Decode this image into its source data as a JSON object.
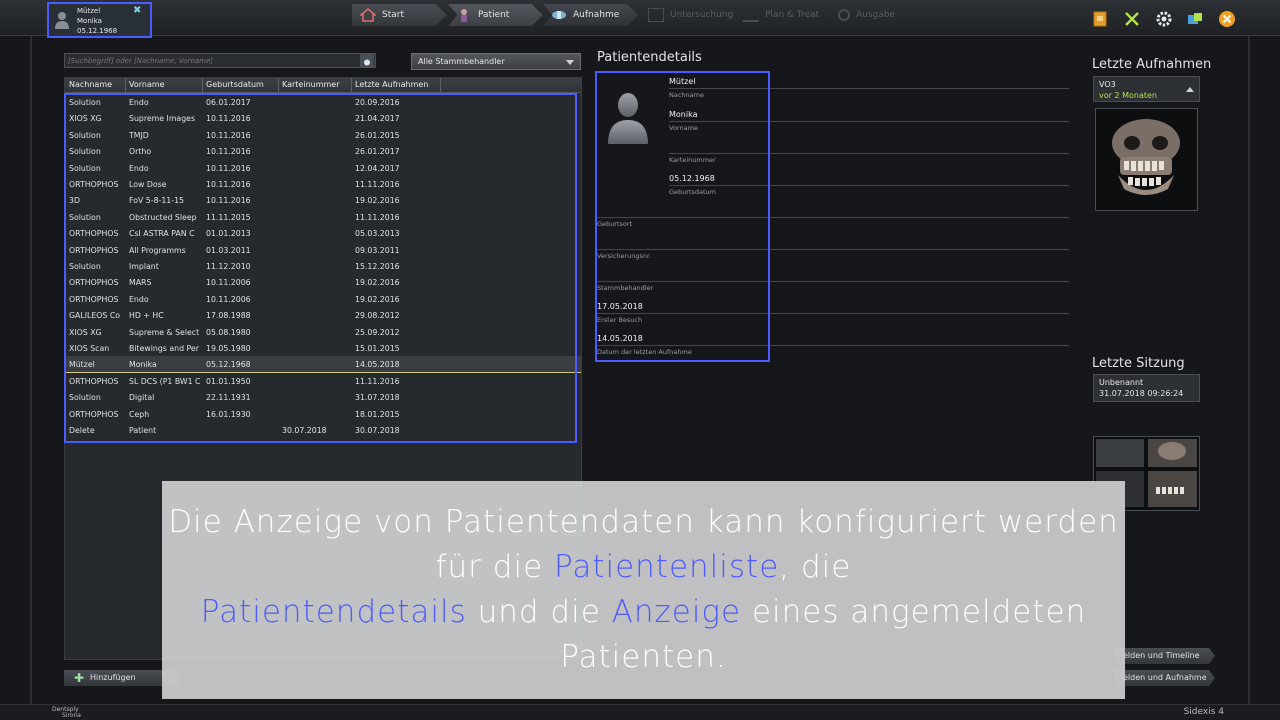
{
  "active_patient": {
    "lastname": "Mützel",
    "firstname": "Monika",
    "birthdate": "05.12.1968"
  },
  "workflow": {
    "start": "Start",
    "patient": "Patient",
    "aufnahme": "Aufnahme",
    "untersuchung": "Untersuchung",
    "plan": "Plan & Treat",
    "ausgabe": "Ausgabe"
  },
  "search": {
    "placeholder": "[Suchbegriff] oder [Nachname, Vorname]",
    "doctor_filter": "Alle Stammbehandler"
  },
  "table": {
    "headers": [
      "Nachname",
      "Vorname",
      "Geburtsdatum",
      "Karteinummer",
      "Letzte Aufnahmen"
    ],
    "rows": [
      [
        "Solution",
        "Endo",
        "06.01.2017",
        "",
        "20.09.2016"
      ],
      [
        "XIOS XG",
        "Supreme Images",
        "10.11.2016",
        "",
        "21.04.2017"
      ],
      [
        "Solution",
        "TMJD",
        "10.11.2016",
        "",
        "26.01.2015"
      ],
      [
        "Solution",
        "Ortho",
        "10.11.2016",
        "",
        "26.01.2017"
      ],
      [
        "Solution",
        "Endo",
        "10.11.2016",
        "",
        "12.04.2017"
      ],
      [
        "ORTHOPHOS",
        "Low Dose",
        "10.11.2016",
        "",
        "11.11.2016"
      ],
      [
        "3D",
        "FoV 5-8-11-15",
        "10.11.2016",
        "",
        "19.02.2016"
      ],
      [
        "Solution",
        "Obstructed Sleep",
        "11.11.2015",
        "",
        "11.11.2016"
      ],
      [
        "ORTHOPHOS",
        "CsI ASTRA PAN C",
        "01.01.2013",
        "",
        "05.03.2013"
      ],
      [
        "ORTHOPHOS",
        "All Programms",
        "01.03.2011",
        "",
        "09.03.2011"
      ],
      [
        "Solution",
        "Implant",
        "11.12.2010",
        "",
        "15.12.2016"
      ],
      [
        "ORTHOPHOS",
        "MARS",
        "10.11.2006",
        "",
        "19.02.2016"
      ],
      [
        "ORTHOPHOS",
        "Endo",
        "10.11.2006",
        "",
        "19.02.2016"
      ],
      [
        "GALILEOS Co",
        "HD + HC",
        "17.08.1988",
        "",
        "29.08.2012"
      ],
      [
        "XIOS XG",
        "Supreme & Select",
        "05.08.1980",
        "",
        "25.09.2012"
      ],
      [
        "XIOS Scan",
        "Bitewings and Per",
        "19.05.1980",
        "",
        "15.01.2015"
      ],
      [
        "Mützel",
        "Monika",
        "05.12.1968",
        "",
        "14.05.2018"
      ],
      [
        "ORTHOPHOS",
        "SL DCS (P1 BW1 C",
        "01.01.1950",
        "",
        "11.11.2016"
      ],
      [
        "Solution",
        "Digital",
        "22.11.1931",
        "",
        "31.07.2018"
      ],
      [
        "ORTHOPHOS",
        "Ceph",
        "16.01.1930",
        "",
        "18.01.2015"
      ],
      [
        "Delete",
        "Patient",
        "",
        "30.07.2018",
        "30.07.2018"
      ]
    ],
    "selected_index": 16
  },
  "add_button": "Hinzufügen",
  "details": {
    "title": "Patientendetails",
    "nachname_value": "Mützel",
    "nachname_label": "Nachname",
    "vorname_value": "Monika",
    "vorname_label": "Vorname",
    "karteinummer_label": "Karteinummer",
    "geburtsdatum_value": "05.12.1968",
    "geburtsdatum_label": "Geburtsdatum",
    "geburtsort_label": "Geburtsort",
    "versicherung_label": "Versicherungsnr.",
    "stammbehandler_label": "Stammbehandler",
    "erster_besuch_value": "17.05.2018",
    "erster_besuch_label": "Erster Besuch",
    "letzte_aufnahme_value": "14.05.2018",
    "letzte_aufnahme_label": "Datum der letzten Aufnahme"
  },
  "letzte_aufnahmen": {
    "title": "Letzte Aufnahmen",
    "item_name": "VO3",
    "item_age": "vor 2 Monaten"
  },
  "letzte_sitzung": {
    "title": "Letzte Sitzung",
    "name": "Unbenannt",
    "timestamp": "31.07.2018 09:26:24"
  },
  "side_buttons": {
    "timeline": "elden und Timeline",
    "aufnahme": "elden und Aufnahme"
  },
  "caption": {
    "part1": "Die Anzeige von Patientendaten kann konfiguriert werden für die ",
    "hl1": "Patientenliste",
    "part2": ", die ",
    "hl2": "Patientendetails",
    "part3": " und die ",
    "hl3": "Anzeige",
    "part4": " eines angemeldeten Patienten."
  },
  "footer": {
    "brand1": "Dentsply",
    "brand2": "Sirona",
    "version": "Sidexis 4"
  },
  "colors": {
    "highlight": "#4a5bff",
    "accent_green": "#b4e04a"
  }
}
